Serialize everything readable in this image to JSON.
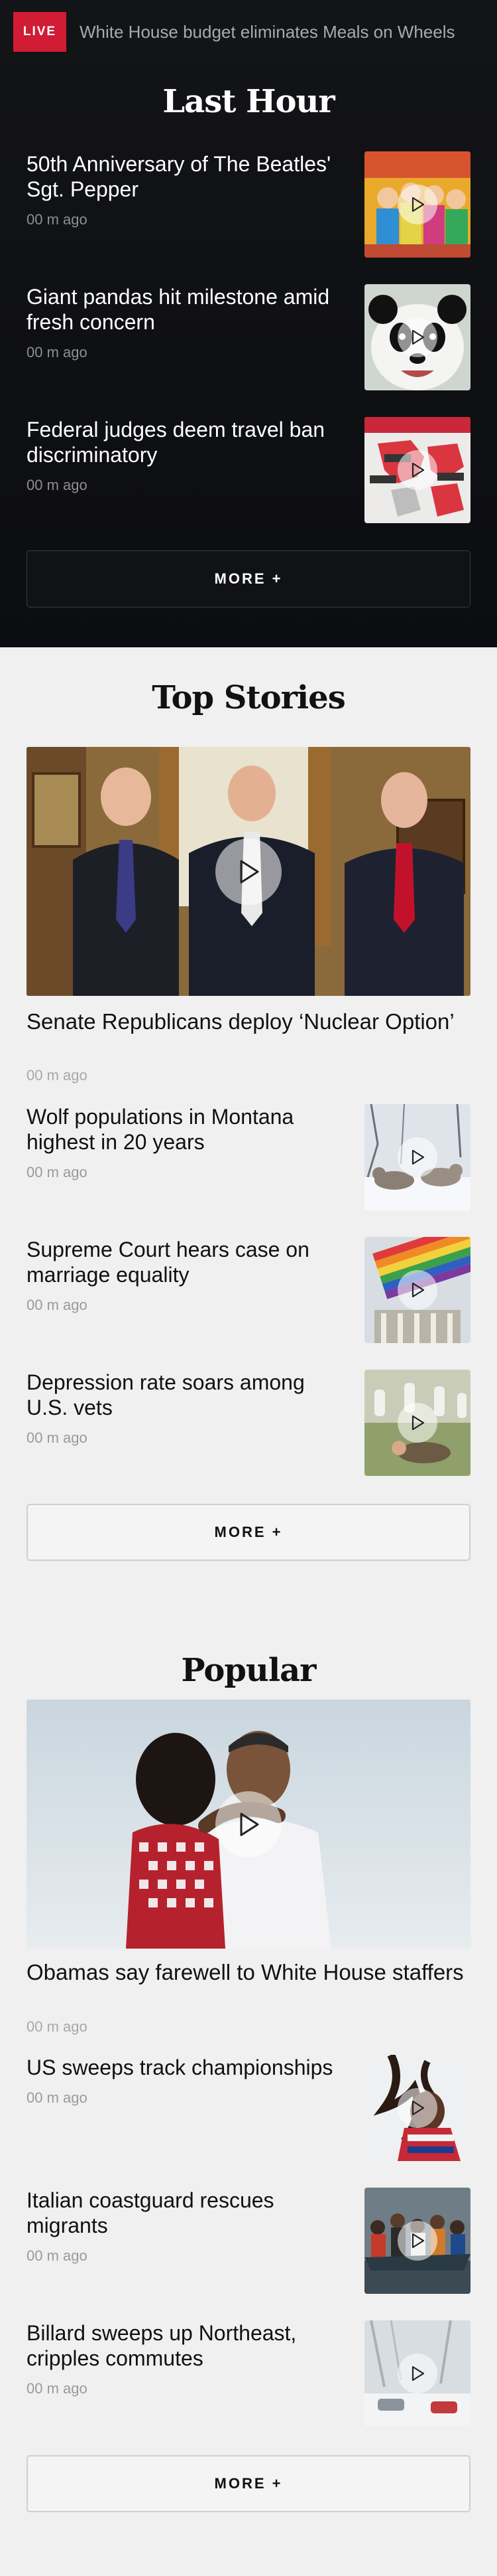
{
  "live_bar": {
    "badge": "LIVE",
    "ticker": "White House budget eliminates Meals on Wheels"
  },
  "last_hour": {
    "title": "Last Hour",
    "items": [
      {
        "headline": "50th Anniversary of The Beatles' Sgt. Pepper",
        "time": "00 m ago",
        "thumb_icon": "beatles-album-thumbnail"
      },
      {
        "headline": "Giant pandas hit milestone amid fresh concern",
        "time": "00 m ago",
        "thumb_icon": "panda-thumbnail"
      },
      {
        "headline": "Federal judges deem travel ban discriminatory",
        "time": "00 m ago",
        "thumb_icon": "travel-ban-map-thumbnail"
      }
    ],
    "more": "MORE +"
  },
  "top_stories": {
    "title": "Top Stories",
    "hero": {
      "headline": "Senate Republicans deploy ‘Nuclear Option’",
      "time": "00 m ago"
    },
    "items": [
      {
        "headline": "Wolf populations in Montana highest in 20 years",
        "time": "00 m ago",
        "thumb_icon": "wolves-thumbnail"
      },
      {
        "headline": "Supreme Court hears case on marriage equality",
        "time": "00 m ago",
        "thumb_icon": "rainbow-flag-court-thumbnail"
      },
      {
        "headline": "Depression rate soars among U.S. vets",
        "time": "00 m ago",
        "thumb_icon": "cemetery-thumbnail"
      }
    ],
    "more": "MORE +"
  },
  "popular": {
    "title": "Popular",
    "hero": {
      "headline": "Obamas say farewell to White House staffers",
      "time": "00 m ago"
    },
    "items": [
      {
        "headline": "US sweeps track championships",
        "time": "00 m ago",
        "thumb_icon": "track-athlete-thumbnail"
      },
      {
        "headline": "Italian coastguard rescues migrants",
        "time": "00 m ago",
        "thumb_icon": "migrant-boat-thumbnail"
      },
      {
        "headline": "Billard sweeps up Northeast, cripples commutes",
        "time": "00 m ago",
        "thumb_icon": "snow-street-thumbnail"
      }
    ],
    "more": "MORE +"
  },
  "colors": {
    "live_red": "#d01c35",
    "dark_bg": "#131417",
    "light_bg": "#f0f0f0"
  }
}
